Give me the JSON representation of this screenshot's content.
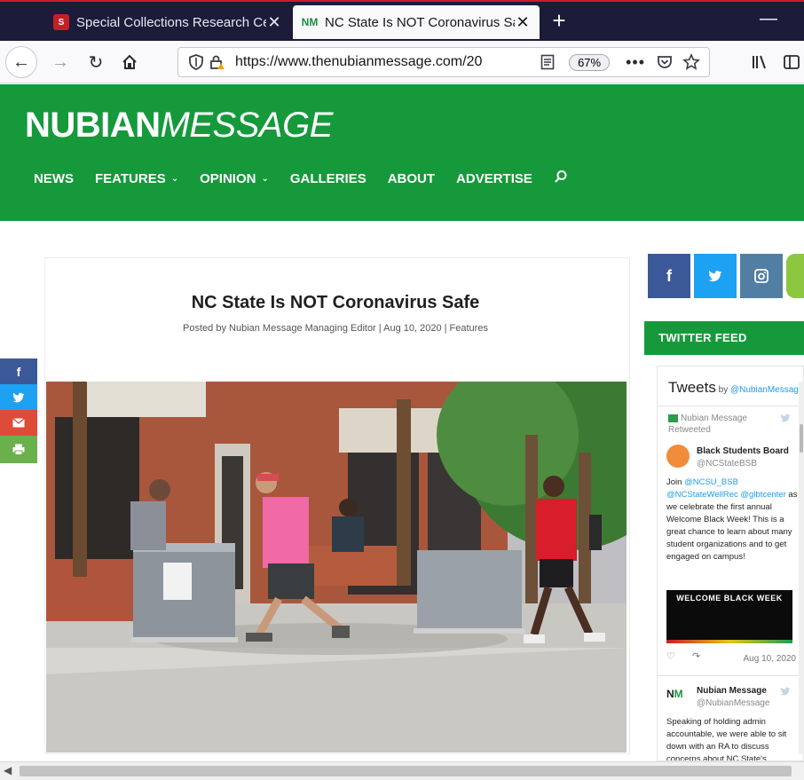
{
  "browser": {
    "tabs": [
      {
        "favicon": "S",
        "title": "Special Collections Research Ce",
        "close": "✕"
      },
      {
        "favicon": "NM",
        "title": "NC State Is NOT Coronavirus Sa",
        "close": "✕"
      }
    ],
    "new_tab": "+",
    "minimize": "—",
    "url": "https://www.thenubianmessage.com/20",
    "zoom": "67%",
    "more": "•••",
    "icons": [
      "back-arrow-icon",
      "forward-arrow-icon",
      "reload-icon",
      "home-icon",
      "shield-icon",
      "lock-warning-icon",
      "reader-view-icon",
      "pocket-icon",
      "star-icon",
      "library-icon",
      "sidebar-icon"
    ]
  },
  "site": {
    "logo_bold": "NUBIAN",
    "logo_light": "MESSAGE",
    "nav": [
      {
        "label": "NEWS",
        "has_menu": false
      },
      {
        "label": "FEATURES",
        "has_menu": true
      },
      {
        "label": "OPINION",
        "has_menu": true
      },
      {
        "label": "GALLERIES",
        "has_menu": false
      },
      {
        "label": "ABOUT",
        "has_menu": false
      },
      {
        "label": "ADVERTISE",
        "has_menu": false
      }
    ],
    "brand_color": "#16993b"
  },
  "article": {
    "title": "NC State Is NOT Coronavirus Safe",
    "meta_prefix": "Posted by ",
    "author": "Nubian Message Managing Editor",
    "sep1": " | ",
    "date": "Aug 10, 2020",
    "sep2": " | ",
    "category": "Features"
  },
  "share_rail": [
    {
      "icon": "facebook-icon",
      "glyph": "f",
      "color": "#3b5998"
    },
    {
      "icon": "twitter-icon",
      "glyph": "🐦",
      "color": "#1da1f2"
    },
    {
      "icon": "email-icon",
      "glyph": "✉",
      "color": "#dd4b39"
    },
    {
      "icon": "print-icon",
      "glyph": "⎙",
      "color": "#6ab04c"
    }
  ],
  "sidebar": {
    "social": [
      {
        "icon": "facebook-icon",
        "glyph": "f",
        "color": "#3b5998"
      },
      {
        "icon": "twitter-icon",
        "glyph": "🐦",
        "color": "#1da1f2"
      },
      {
        "icon": "instagram-icon",
        "glyph": "◙",
        "color": "#517fa4"
      },
      {
        "icon": "extra-social-icon",
        "glyph": "",
        "color": "#8dc63f"
      }
    ],
    "twitter_feed_heading": "TWITTER FEED",
    "tweets_title": "Tweets",
    "tweets_by": " by ",
    "tweets_handle": "@NubianMessage",
    "retweet_line1": "Nubian Message",
    "retweet_line2": "Retweeted",
    "tweet1": {
      "name": "Black Students Board",
      "handle": "@NCStateBSB",
      "body_parts": [
        {
          "t": "Join ",
          "m": false
        },
        {
          "t": "@NCSU_BSB",
          "m": true
        },
        {
          "t": " ",
          "m": false
        },
        {
          "t": "@NCStateWellRec",
          "m": true
        },
        {
          "t": " ",
          "m": false
        },
        {
          "t": "@glbtcenter",
          "m": true
        },
        {
          "t": " as we celebrate the first annual Welcome Black Week! This is a great chance to learn about many student organizations and to get engaged on campus!",
          "m": false
        }
      ],
      "image_text": "WELCOME BLACK WEEK",
      "date": "Aug 10, 2020"
    },
    "tweet2": {
      "name": "Nubian Message",
      "handle": "@NubianMessage",
      "body": "Speaking of holding admin accountable, we were able to sit down with an RA to discuss concerns about NC State's"
    }
  }
}
